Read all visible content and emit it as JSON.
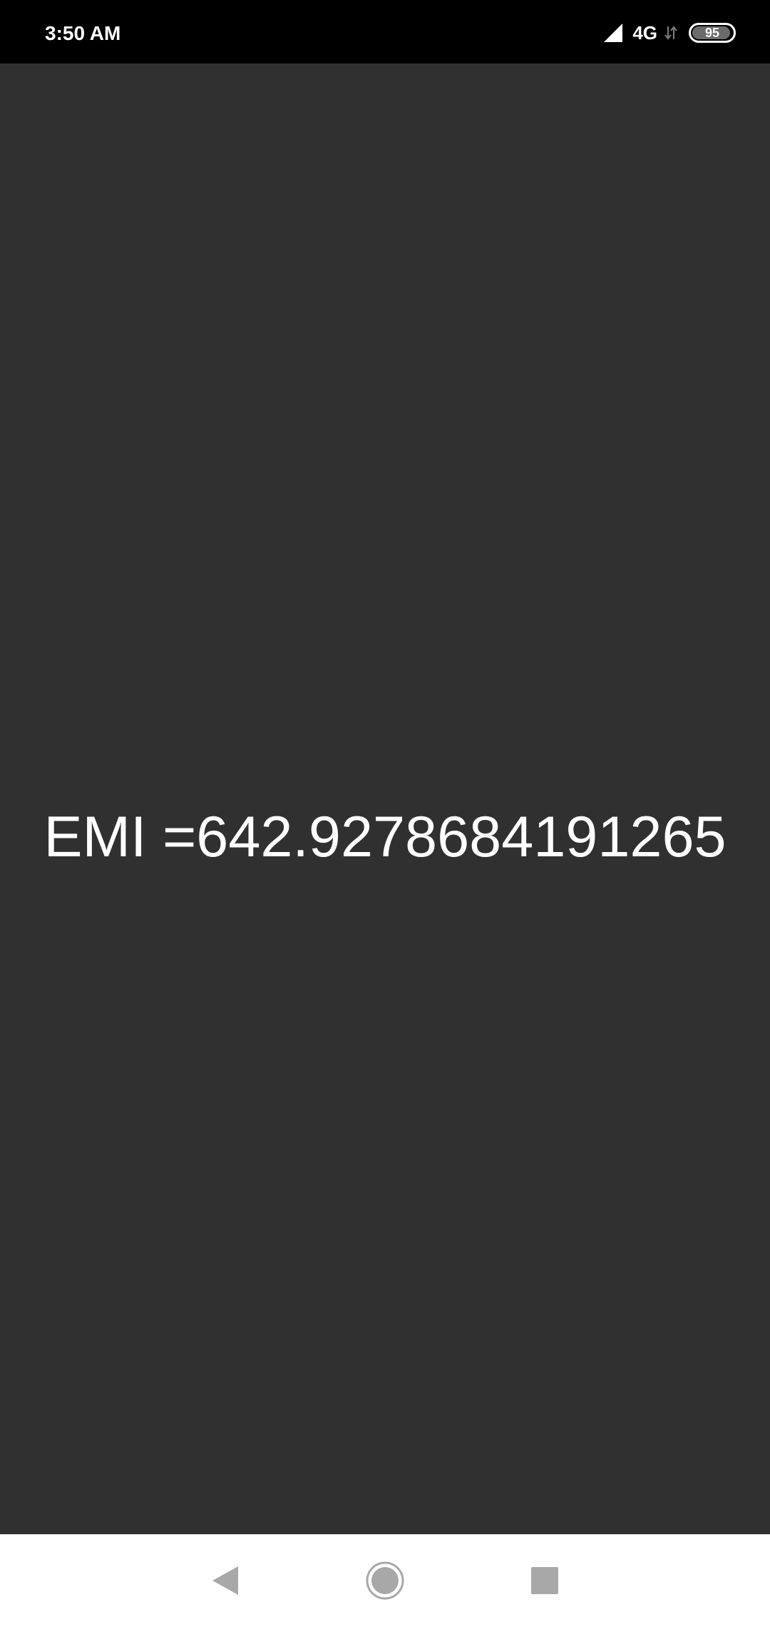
{
  "status_bar": {
    "time": "3:50 AM",
    "network": "4G",
    "battery_level": "95",
    "battery_fraction": 0.95,
    "icons": [
      "signal-icon",
      "data-activity-icon",
      "battery-icon"
    ]
  },
  "main": {
    "result_text": "EMI =642.9278684191265"
  },
  "nav_bar": {
    "buttons": [
      "back-icon",
      "home-icon",
      "recents-icon"
    ]
  },
  "colors": {
    "status_bar_bg": "#000000",
    "content_bg": "#303030",
    "text": "#ffffff",
    "nav_bar_bg": "#ffffff",
    "nav_icon": "#9e9e9e"
  }
}
